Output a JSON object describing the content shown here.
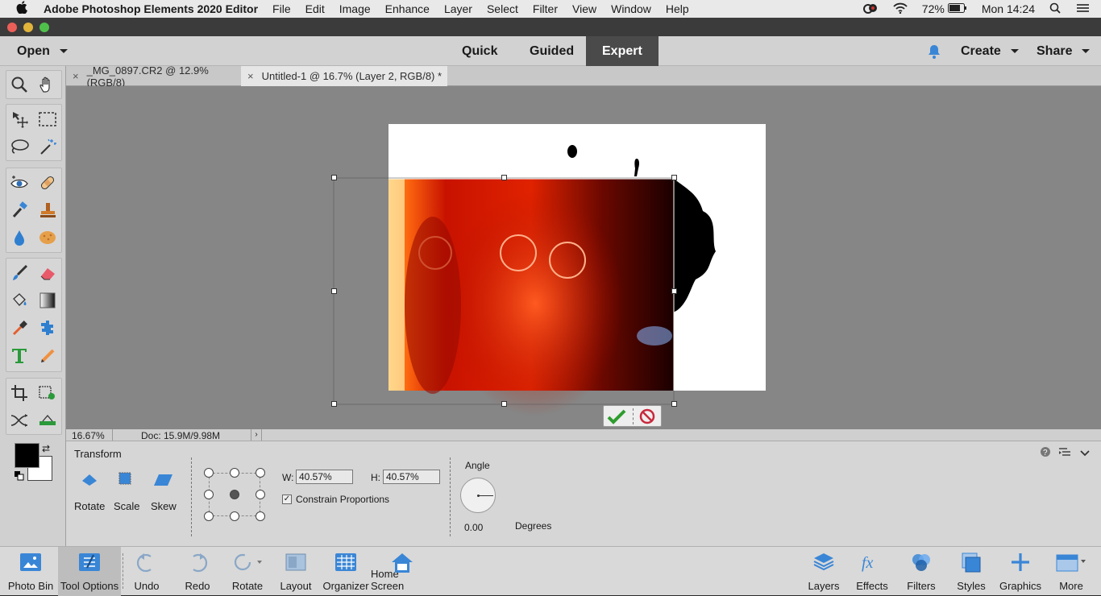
{
  "menubar": {
    "app_name": "Adobe Photoshop Elements 2020 Editor",
    "items": [
      "File",
      "Edit",
      "Image",
      "Enhance",
      "Layer",
      "Select",
      "Filter",
      "View",
      "Window",
      "Help"
    ],
    "battery": "72%",
    "clock": "Mon 14:24"
  },
  "topbar": {
    "open_label": "Open",
    "modes": [
      "Quick",
      "Guided",
      "Expert"
    ],
    "active_mode": "Expert",
    "create_label": "Create",
    "share_label": "Share"
  },
  "tabs": [
    {
      "title": "_MG_0897.CR2 @ 12.9% (RGB/8)",
      "active": false
    },
    {
      "title": "Untitled-1 @ 16.7% (Layer 2, RGB/8) *",
      "active": true
    }
  ],
  "statusbar": {
    "zoom": "16.67%",
    "doc": "Doc: 15.9M/9.98M"
  },
  "options": {
    "title": "Transform",
    "modes": [
      "Rotate",
      "Scale",
      "Skew"
    ],
    "w_label": "W:",
    "w_value": "40.57%",
    "h_label": "H:",
    "h_value": "40.57%",
    "constrain_label": "Constrain Proportions",
    "constrain_checked": true,
    "angle_label": "Angle",
    "angle_value": "0.00",
    "degrees_label": "Degrees"
  },
  "bottombar": {
    "left": [
      "Photo Bin",
      "Tool Options",
      "Undo",
      "Redo",
      "Rotate",
      "Layout",
      "Organizer",
      "Home Screen"
    ],
    "right": [
      "Layers",
      "Effects",
      "Filters",
      "Styles",
      "Graphics",
      "More"
    ]
  },
  "colors": {
    "accent_blue": "#3a86d6",
    "commit_green": "#2e9d2e",
    "cancel_red": "#c8283c"
  },
  "icons": {
    "tools": [
      "zoom-icon",
      "hand-icon",
      "move-icon",
      "marquee-icon",
      "lasso-icon",
      "magic-wand-icon",
      "red-eye-icon",
      "spot-healing-icon",
      "smart-brush-icon",
      "clone-stamp-icon",
      "blur-icon",
      "sponge-icon",
      "brush-icon",
      "eraser-icon",
      "paint-bucket-icon",
      "gradient-icon",
      "eyedropper-icon",
      "custom-shape-icon",
      "type-icon",
      "pencil-icon",
      "crop-icon",
      "recompose-icon",
      "content-aware-move-icon",
      "straighten-icon"
    ]
  }
}
